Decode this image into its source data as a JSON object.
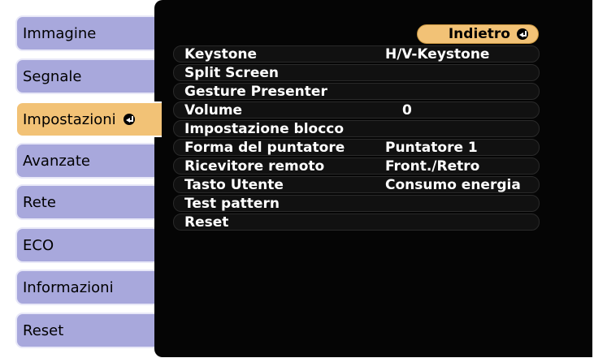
{
  "sidebar": {
    "items": [
      {
        "label": "Immagine"
      },
      {
        "label": "Segnale"
      },
      {
        "label": "Impostazioni"
      },
      {
        "label": "Avanzate"
      },
      {
        "label": "Rete"
      },
      {
        "label": "ECO"
      },
      {
        "label": "Informazioni"
      },
      {
        "label": "Reset"
      }
    ],
    "active": "Impostazioni"
  },
  "back_button": {
    "label": "Indietro"
  },
  "settings": [
    {
      "label": "Keystone",
      "value": "H/V-Keystone"
    },
    {
      "label": "Split Screen",
      "value": ""
    },
    {
      "label": "Gesture Presenter",
      "value": ""
    },
    {
      "label": "Volume",
      "value": "0"
    },
    {
      "label": "Impostazione blocco",
      "value": ""
    },
    {
      "label": "Forma del puntatore",
      "value": "Puntatore 1"
    },
    {
      "label": "Ricevitore remoto",
      "value": "Front./Retro"
    },
    {
      "label": "Tasto Utente",
      "value": "Consumo energia"
    },
    {
      "label": "Test pattern",
      "value": ""
    },
    {
      "label": "Reset",
      "value": ""
    }
  ],
  "colors": {
    "tab_bg": "#a8a8dc",
    "active_tab_bg": "#f2c276",
    "panel_bg": "#050505",
    "text_light": "#ffffff"
  },
  "icons": {
    "enter": "enter-icon"
  }
}
